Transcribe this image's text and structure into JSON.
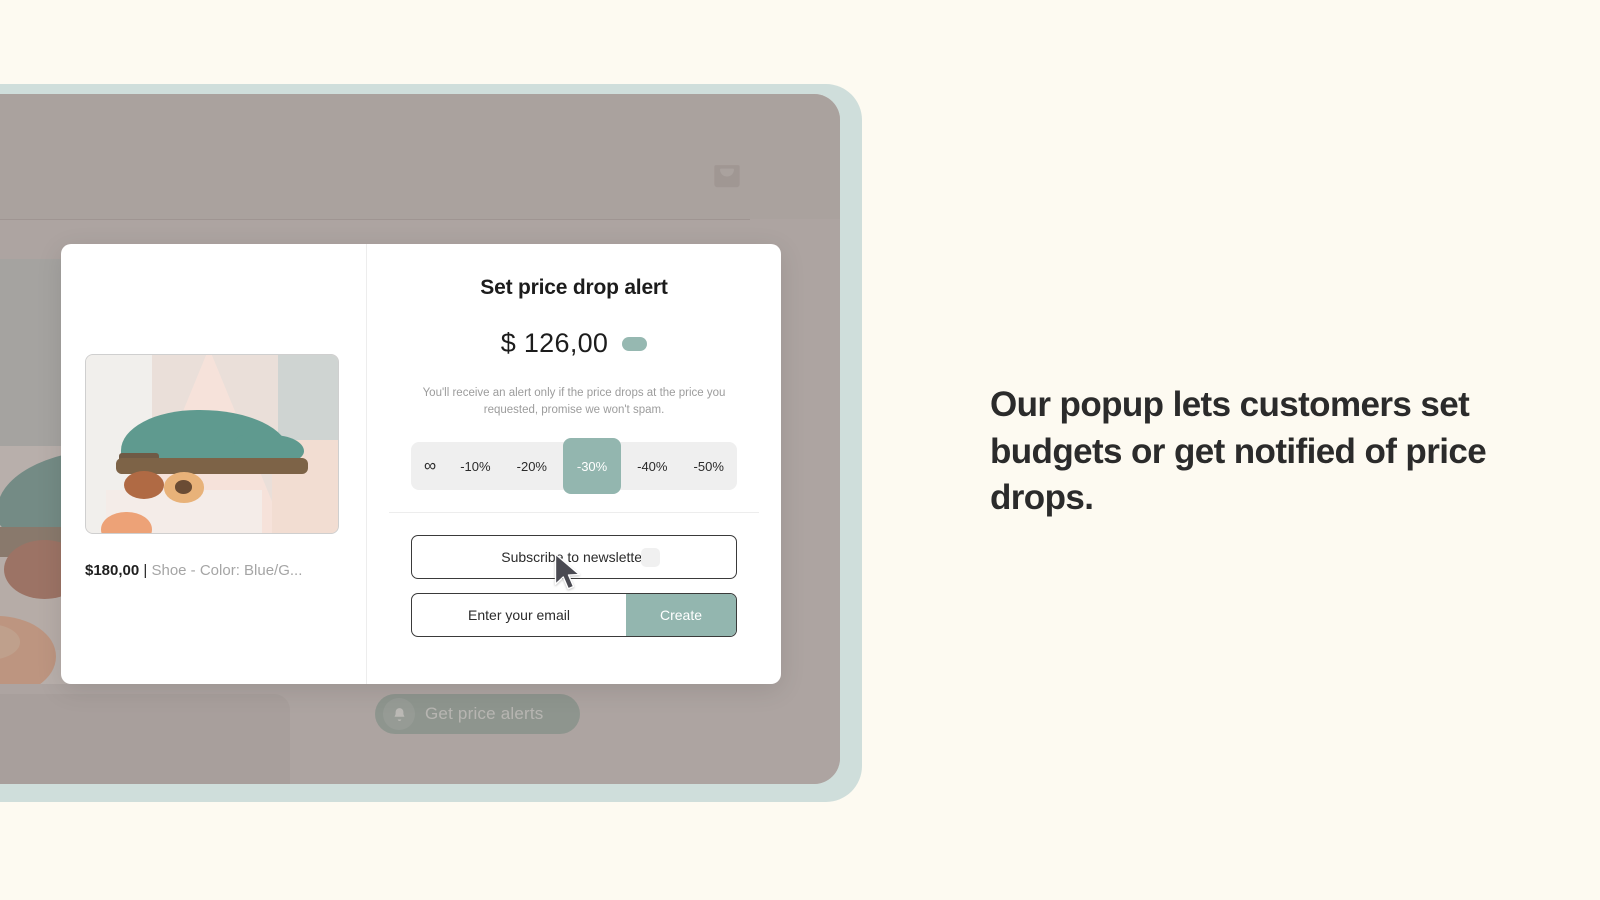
{
  "marketing": {
    "headline": "Our popup lets customers set budgets or get notified of price drops."
  },
  "store": {
    "bag_icon": "shopping-bag-icon",
    "alerts_button": {
      "label": "Get price alerts",
      "icon": "bell-icon"
    }
  },
  "modal": {
    "title": "Set price drop alert",
    "price": {
      "currency": "$",
      "value": "126,00",
      "display": "$  126,00",
      "toggle_state": "on"
    },
    "hint": "You'll receive an alert only if the price drops at the price you requested, promise we won't spam.",
    "discount_options": [
      {
        "label": "∞",
        "name": "infinity",
        "selected": false
      },
      {
        "label": "-10%",
        "name": "minus-10",
        "selected": false
      },
      {
        "label": "-20%",
        "name": "minus-20",
        "selected": false
      },
      {
        "label": "-30%",
        "name": "minus-30",
        "selected": true
      },
      {
        "label": "-40%",
        "name": "minus-40",
        "selected": false
      },
      {
        "label": "-50%",
        "name": "minus-50",
        "selected": false
      }
    ],
    "newsletter": {
      "label": "Subscribe to newsletter",
      "checked": false
    },
    "email": {
      "placeholder": "Enter your email",
      "value": ""
    },
    "create_button": "Create",
    "product": {
      "price": "$180,00",
      "separator": "|",
      "description": "Shoe - Color: Blue/G...",
      "image_alt": "teal-suede-brogue-shoe"
    }
  },
  "colors": {
    "page_background": "#fdfaf1",
    "frame": "#cfdedb",
    "screen": "#b4aaa8",
    "accent_teal": "#93b6af",
    "text_dark": "#2b2b2b",
    "text_muted": "#9c9c9c",
    "pill_track": "#efefef"
  }
}
